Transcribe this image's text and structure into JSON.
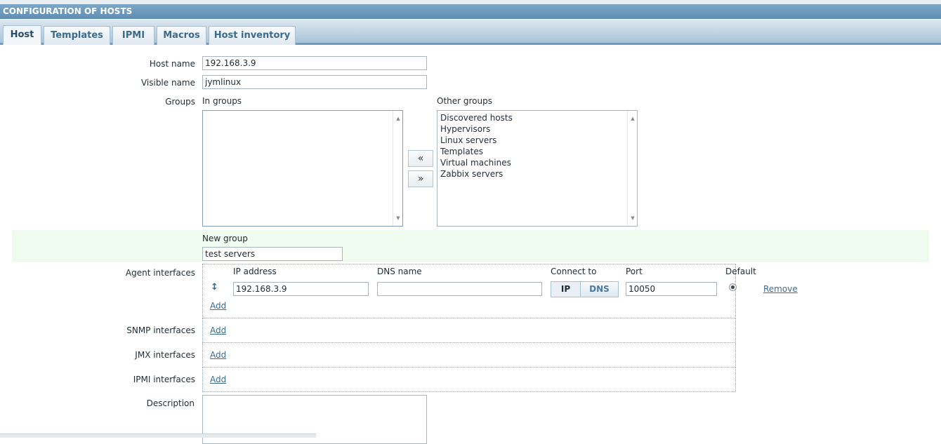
{
  "header": {
    "title": "CONFIGURATION OF HOSTS"
  },
  "tabs": [
    "Host",
    "Templates",
    "IPMI",
    "Macros",
    "Host inventory"
  ],
  "form": {
    "host_name_label": "Host name",
    "host_name_value": "192.168.3.9",
    "visible_name_label": "Visible name",
    "visible_name_value": "jymlinux",
    "groups_label": "Groups",
    "in_groups_label": "In groups",
    "in_groups": [],
    "other_groups_label": "Other groups",
    "other_groups": [
      "Discovered hosts",
      "Hypervisors",
      "Linux servers",
      "Templates",
      "Virtual machines",
      "Zabbix servers"
    ],
    "move_left": "«",
    "move_right": "»",
    "new_group_label": "New group",
    "new_group_value": "test servers",
    "agent_interfaces_label": "Agent interfaces",
    "col_ip": "IP address",
    "col_dns": "DNS name",
    "col_connect": "Connect to",
    "col_port": "Port",
    "col_default": "Default",
    "agent_ip": "192.168.3.9",
    "agent_dns": "",
    "connect_ip": "IP",
    "connect_dns": "DNS",
    "agent_port": "10050",
    "remove": "Remove",
    "add": "Add",
    "snmp_label": "SNMP interfaces",
    "jmx_label": "JMX interfaces",
    "ipmi_label": "IPMI interfaces",
    "description_label": "Description",
    "description_value": ""
  }
}
